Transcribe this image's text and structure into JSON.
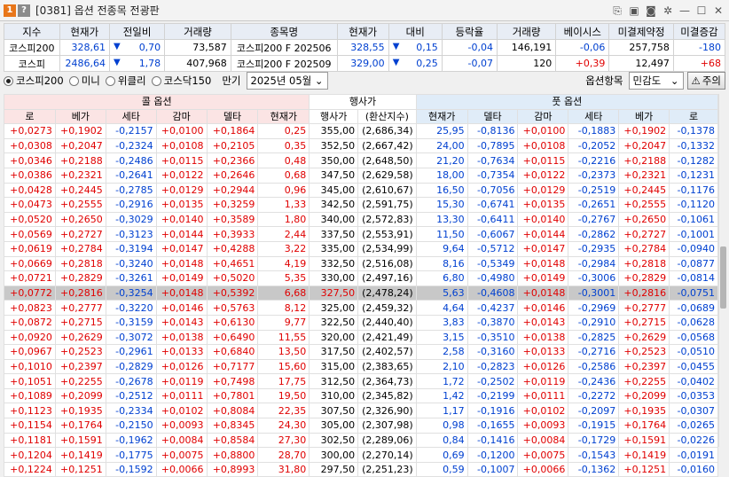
{
  "window": {
    "badge1": "1",
    "badge2": "?",
    "title": "[0381] 옵션 전종목 전광판",
    "icons": [
      "pin-icon",
      "save-icon",
      "camera-icon",
      "settings-icon",
      "minimize-icon",
      "maximize-icon",
      "close-icon"
    ]
  },
  "index": {
    "headers": [
      "지수",
      "현재가",
      "전일비",
      "거래량",
      "종목명",
      "현재가",
      "대비",
      "등락율",
      "거래량",
      "베이시스",
      "미결제약정",
      "미결증감"
    ],
    "rows": [
      {
        "name": "코스피200",
        "price": "328,61",
        "dir": "down",
        "change": "0,70",
        "volume": "73,587",
        "item": "코스피200 F 202506",
        "fprice": "328,55",
        "fdir": "down",
        "fchange": "0,15",
        "rate": "-0,04",
        "fvolume": "146,191",
        "basis": "-0,06",
        "oi": "257,758",
        "oichg": "-180"
      },
      {
        "name": "코스피",
        "price": "2486,64",
        "dir": "down",
        "change": "1,78",
        "volume": "407,968",
        "item": "코스피200 F 202509",
        "fprice": "329,00",
        "fdir": "down",
        "fchange": "0,25",
        "rate": "-0,07",
        "fvolume": "120",
        "basis": "+0,39",
        "oi": "12,497",
        "oichg": "+68"
      }
    ]
  },
  "controls": {
    "radios": [
      "코스피200",
      "미니",
      "위클리",
      "코스닥150"
    ],
    "expiry_label": "만기",
    "expiry_value": "2025년 05월",
    "item_label": "옵션항목",
    "item_value": "민감도",
    "notice": "주의"
  },
  "grid": {
    "call_header": "콜 옵션",
    "strike_header": "행사가",
    "put_header": "풋 옵션",
    "call_cols": [
      "로",
      "베가",
      "세타",
      "감마",
      "델타",
      "현재가"
    ],
    "mid_cols": [
      "행사가",
      "(환산지수)"
    ],
    "put_cols": [
      "현재가",
      "델타",
      "감마",
      "세타",
      "베가",
      "로"
    ],
    "rows": [
      [
        "+0,0273",
        "+0,1902",
        "-0,2157",
        "+0,0100",
        "+0,1864",
        "0,25",
        "355,00",
        "(2,686,34)",
        "25,95",
        "-0,8136",
        "+0,0100",
        "-0,1883",
        "+0,1902",
        "-0,1378"
      ],
      [
        "+0,0308",
        "+0,2047",
        "-0,2324",
        "+0,0108",
        "+0,2105",
        "0,35",
        "352,50",
        "(2,667,42)",
        "24,00",
        "-0,7895",
        "+0,0108",
        "-0,2052",
        "+0,2047",
        "-0,1332"
      ],
      [
        "+0,0346",
        "+0,2188",
        "-0,2486",
        "+0,0115",
        "+0,2366",
        "0,48",
        "350,00",
        "(2,648,50)",
        "21,20",
        "-0,7634",
        "+0,0115",
        "-0,2216",
        "+0,2188",
        "-0,1282"
      ],
      [
        "+0,0386",
        "+0,2321",
        "-0,2641",
        "+0,0122",
        "+0,2646",
        "0,68",
        "347,50",
        "(2,629,58)",
        "18,00",
        "-0,7354",
        "+0,0122",
        "-0,2373",
        "+0,2321",
        "-0,1231"
      ],
      [
        "+0,0428",
        "+0,2445",
        "-0,2785",
        "+0,0129",
        "+0,2944",
        "0,96",
        "345,00",
        "(2,610,67)",
        "16,50",
        "-0,7056",
        "+0,0129",
        "-0,2519",
        "+0,2445",
        "-0,1176"
      ],
      [
        "+0,0473",
        "+0,2555",
        "-0,2916",
        "+0,0135",
        "+0,3259",
        "1,33",
        "342,50",
        "(2,591,75)",
        "15,30",
        "-0,6741",
        "+0,0135",
        "-0,2651",
        "+0,2555",
        "-0,1120"
      ],
      [
        "+0,0520",
        "+0,2650",
        "-0,3029",
        "+0,0140",
        "+0,3589",
        "1,80",
        "340,00",
        "(2,572,83)",
        "13,30",
        "-0,6411",
        "+0,0140",
        "-0,2767",
        "+0,2650",
        "-0,1061"
      ],
      [
        "+0,0569",
        "+0,2727",
        "-0,3123",
        "+0,0144",
        "+0,3933",
        "2,44",
        "337,50",
        "(2,553,91)",
        "11,50",
        "-0,6067",
        "+0,0144",
        "-0,2862",
        "+0,2727",
        "-0,1001"
      ],
      [
        "+0,0619",
        "+0,2784",
        "-0,3194",
        "+0,0147",
        "+0,4288",
        "3,22",
        "335,00",
        "(2,534,99)",
        "9,64",
        "-0,5712",
        "+0,0147",
        "-0,2935",
        "+0,2784",
        "-0,0940"
      ],
      [
        "+0,0669",
        "+0,2818",
        "-0,3240",
        "+0,0148",
        "+0,4651",
        "4,19",
        "332,50",
        "(2,516,08)",
        "8,16",
        "-0,5349",
        "+0,0148",
        "-0,2984",
        "+0,2818",
        "-0,0877"
      ],
      [
        "+0,0721",
        "+0,2829",
        "-0,3261",
        "+0,0149",
        "+0,5020",
        "5,35",
        "330,00",
        "(2,497,16)",
        "6,80",
        "-0,4980",
        "+0,0149",
        "-0,3006",
        "+0,2829",
        "-0,0814"
      ],
      [
        "+0,0772",
        "+0,2816",
        "-0,3254",
        "+0,0148",
        "+0,5392",
        "6,68",
        "327,50",
        "(2,478,24)",
        "5,63",
        "-0,4608",
        "+0,0148",
        "-0,3001",
        "+0,2816",
        "-0,0751"
      ],
      [
        "+0,0823",
        "+0,2777",
        "-0,3220",
        "+0,0146",
        "+0,5763",
        "8,12",
        "325,00",
        "(2,459,32)",
        "4,64",
        "-0,4237",
        "+0,0146",
        "-0,2969",
        "+0,2777",
        "-0,0689"
      ],
      [
        "+0,0872",
        "+0,2715",
        "-0,3159",
        "+0,0143",
        "+0,6130",
        "9,77",
        "322,50",
        "(2,440,40)",
        "3,83",
        "-0,3870",
        "+0,0143",
        "-0,2910",
        "+0,2715",
        "-0,0628"
      ],
      [
        "+0,0920",
        "+0,2629",
        "-0,3072",
        "+0,0138",
        "+0,6490",
        "11,55",
        "320,00",
        "(2,421,49)",
        "3,15",
        "-0,3510",
        "+0,0138",
        "-0,2825",
        "+0,2629",
        "-0,0568"
      ],
      [
        "+0,0967",
        "+0,2523",
        "-0,2961",
        "+0,0133",
        "+0,6840",
        "13,50",
        "317,50",
        "(2,402,57)",
        "2,58",
        "-0,3160",
        "+0,0133",
        "-0,2716",
        "+0,2523",
        "-0,0510"
      ],
      [
        "+0,1010",
        "+0,2397",
        "-0,2829",
        "+0,0126",
        "+0,7177",
        "15,60",
        "315,00",
        "(2,383,65)",
        "2,10",
        "-0,2823",
        "+0,0126",
        "-0,2586",
        "+0,2397",
        "-0,0455"
      ],
      [
        "+0,1051",
        "+0,2255",
        "-0,2678",
        "+0,0119",
        "+0,7498",
        "17,75",
        "312,50",
        "(2,364,73)",
        "1,72",
        "-0,2502",
        "+0,0119",
        "-0,2436",
        "+0,2255",
        "-0,0402"
      ],
      [
        "+0,1089",
        "+0,2099",
        "-0,2512",
        "+0,0111",
        "+0,7801",
        "19,50",
        "310,00",
        "(2,345,82)",
        "1,42",
        "-0,2199",
        "+0,0111",
        "-0,2272",
        "+0,2099",
        "-0,0353"
      ],
      [
        "+0,1123",
        "+0,1935",
        "-0,2334",
        "+0,0102",
        "+0,8084",
        "22,35",
        "307,50",
        "(2,326,90)",
        "1,17",
        "-0,1916",
        "+0,0102",
        "-0,2097",
        "+0,1935",
        "-0,0307"
      ],
      [
        "+0,1154",
        "+0,1764",
        "-0,2150",
        "+0,0093",
        "+0,8345",
        "24,30",
        "305,00",
        "(2,307,98)",
        "0,98",
        "-0,1655",
        "+0,0093",
        "-0,1915",
        "+0,1764",
        "-0,0265"
      ],
      [
        "+0,1181",
        "+0,1591",
        "-0,1962",
        "+0,0084",
        "+0,8584",
        "27,30",
        "302,50",
        "(2,289,06)",
        "0,84",
        "-0,1416",
        "+0,0084",
        "-0,1729",
        "+0,1591",
        "-0,0226"
      ],
      [
        "+0,1204",
        "+0,1419",
        "-0,1775",
        "+0,0075",
        "+0,8800",
        "28,70",
        "300,00",
        "(2,270,14)",
        "0,69",
        "-0,1200",
        "+0,0075",
        "-0,1543",
        "+0,1419",
        "-0,0191"
      ],
      [
        "+0,1224",
        "+0,1251",
        "-0,1592",
        "+0,0066",
        "+0,8993",
        "31,80",
        "297,50",
        "(2,251,23)",
        "0,59",
        "-0,1007",
        "+0,0066",
        "-0,1362",
        "+0,1251",
        "-0,0160"
      ]
    ],
    "selected_row": 11
  }
}
